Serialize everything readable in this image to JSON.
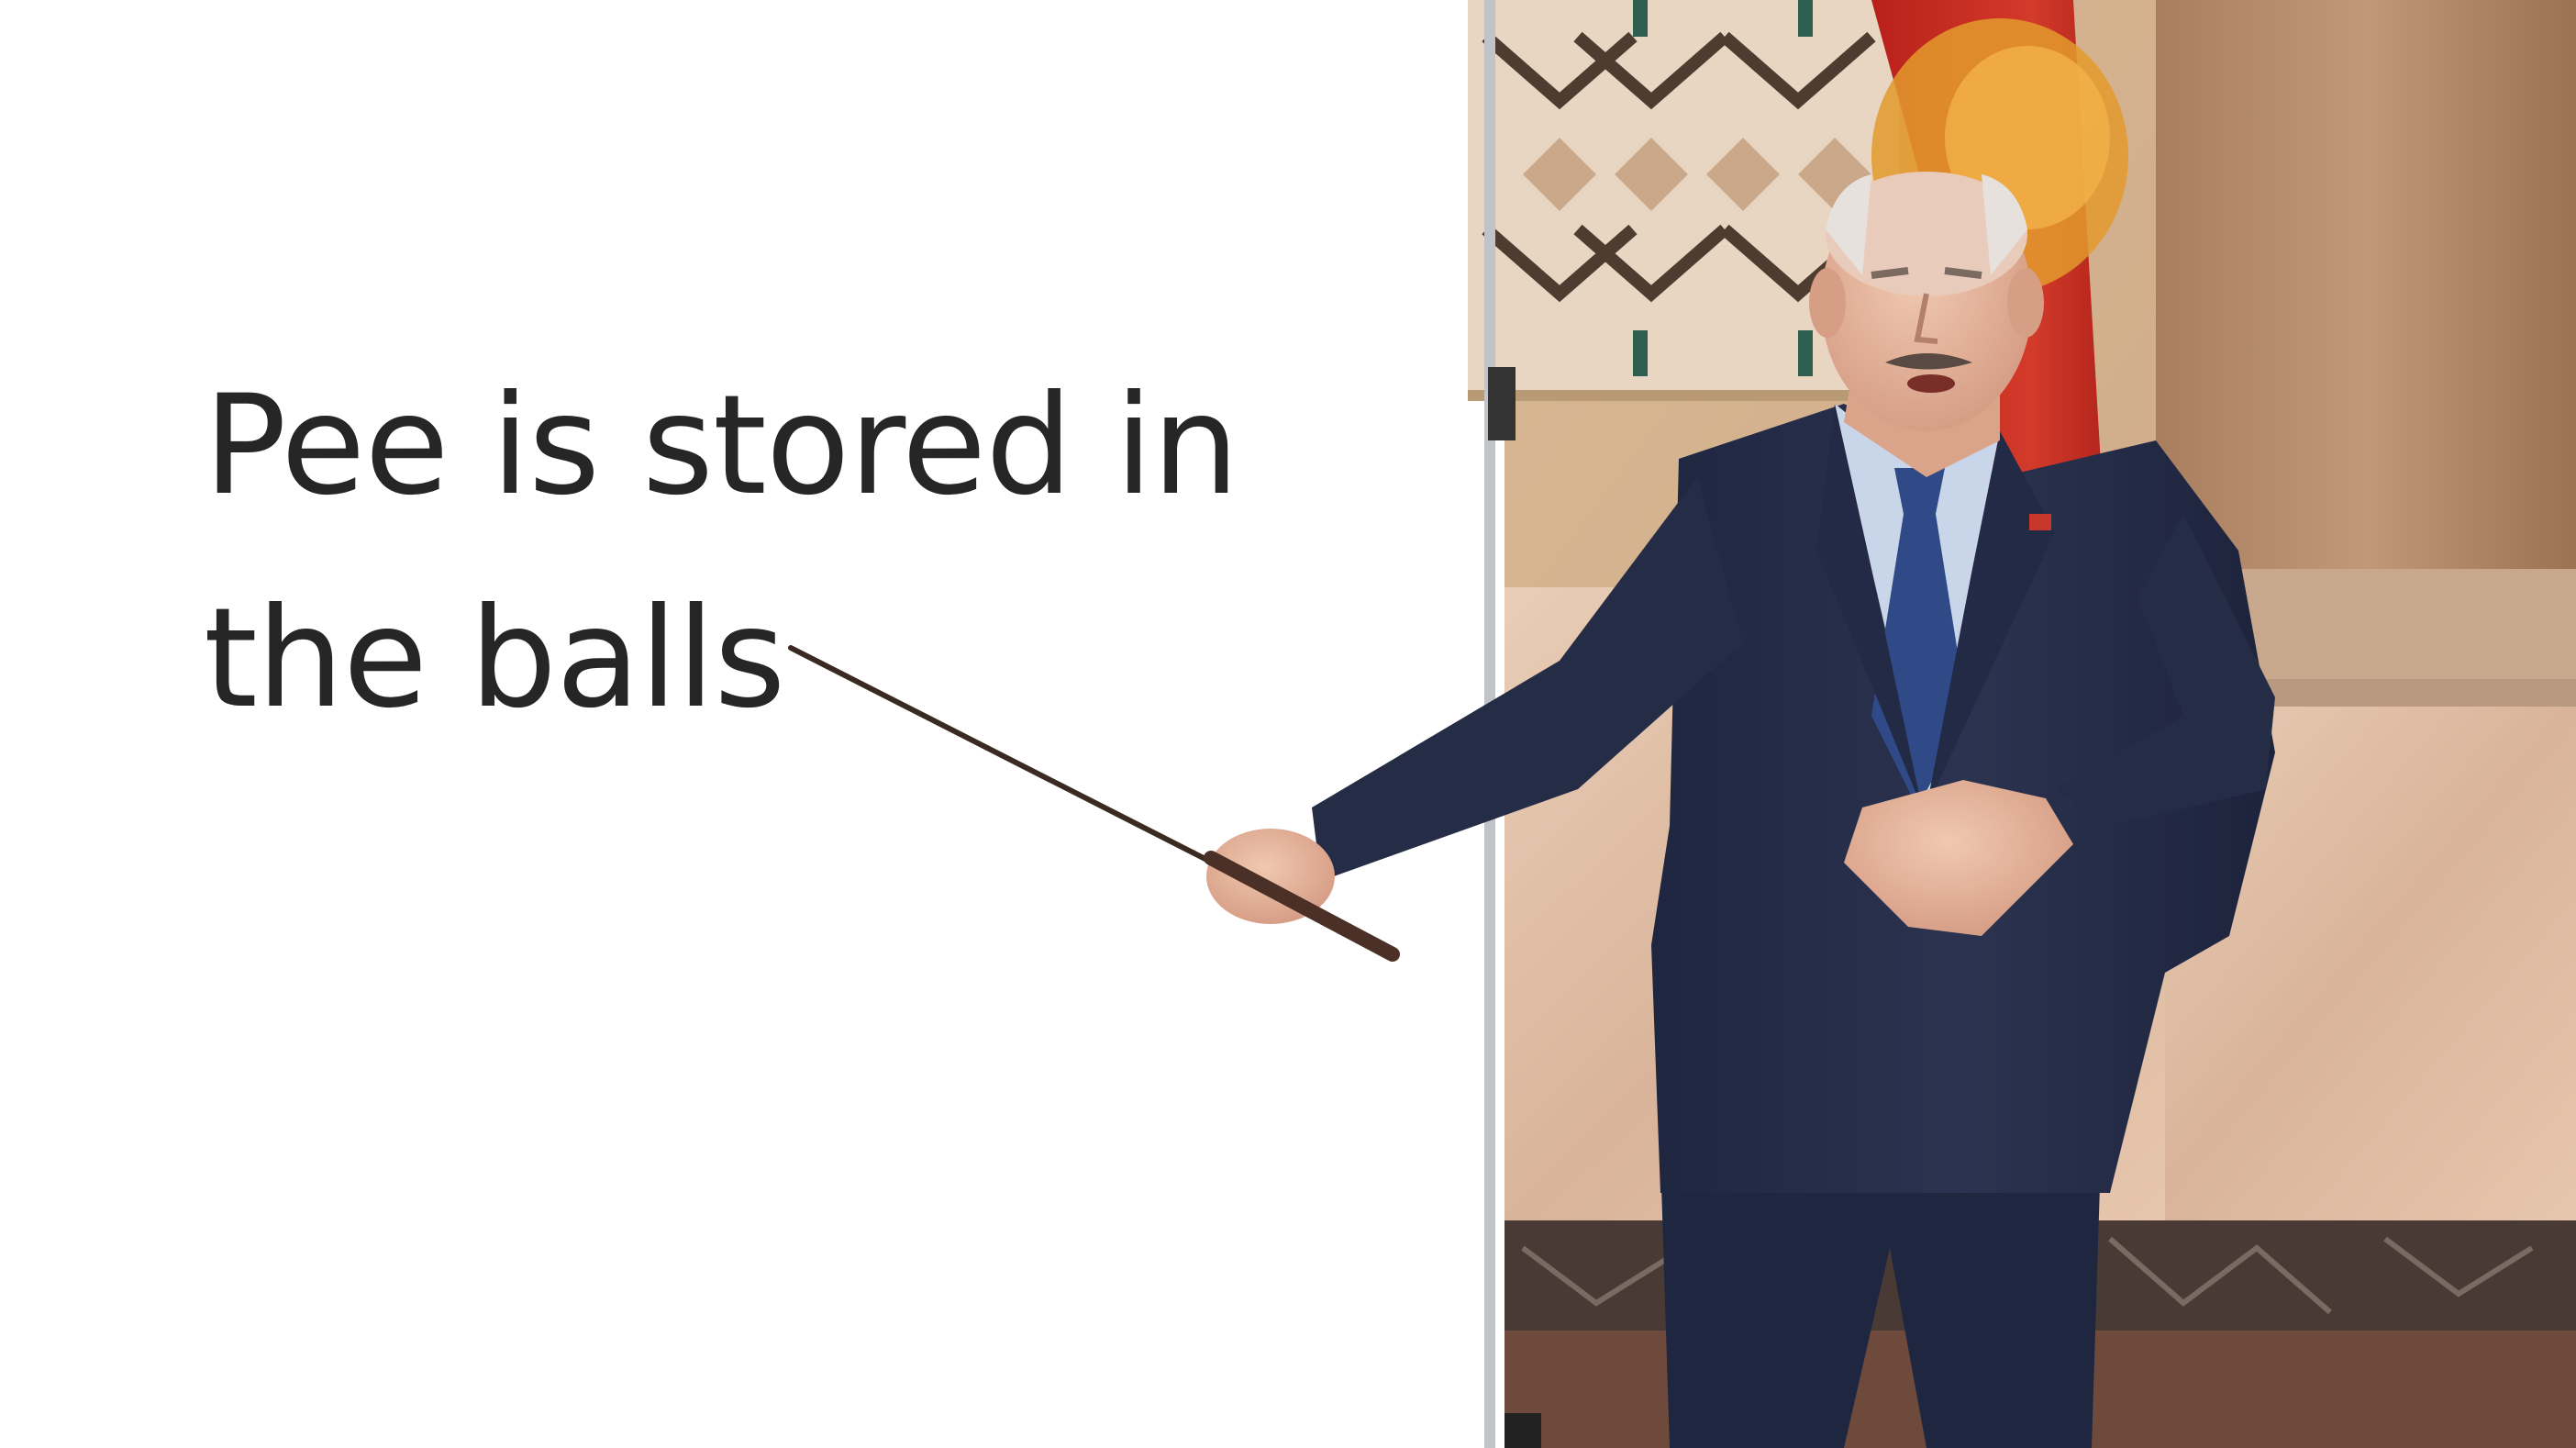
{
  "caption": {
    "line1": "Pee is stored in",
    "line2": "the balls"
  },
  "colors": {
    "text": "#262626",
    "suit": "#252c45",
    "tie": "#2f4a86",
    "shirt": "#c9d6ea",
    "flag_red": "#c62a20",
    "flag_green": "#3f8f3a",
    "wall": "#e2c7a8",
    "pillar": "#b78d6c",
    "floor": "#6e4a3c"
  },
  "scene": {
    "objects": [
      "whiteboard",
      "pointer-stick",
      "presenter",
      "flag",
      "patterned-wall",
      "marble-pillar"
    ]
  }
}
